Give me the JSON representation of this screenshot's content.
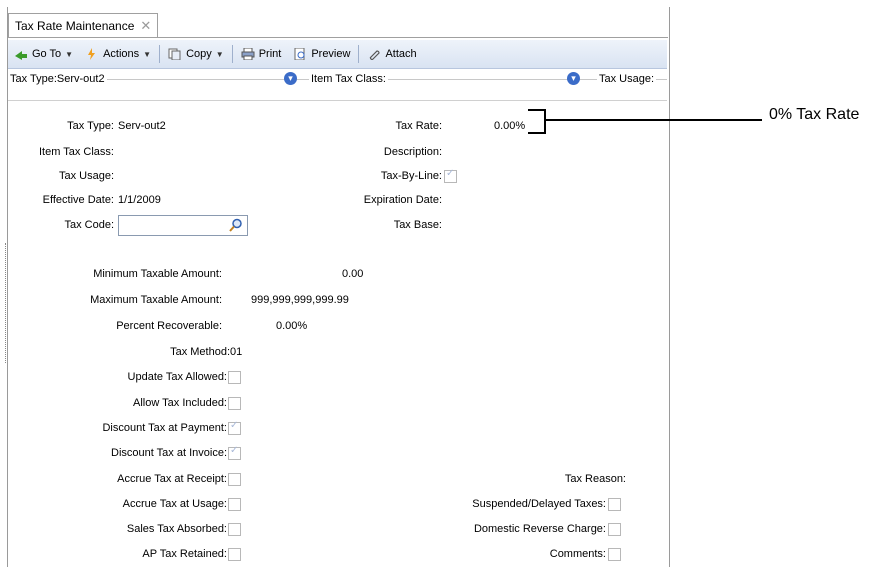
{
  "tab": {
    "title": "Tax Rate Maintenance",
    "close": "✕"
  },
  "toolbar": {
    "goto": "Go To",
    "actions": "Actions",
    "copy": "Copy",
    "print": "Print",
    "preview": "Preview",
    "attach": "Attach"
  },
  "filter": {
    "tax_type": "Tax Type:Serv-out2",
    "item_tax_class": "Item Tax Class:",
    "tax_usage": "Tax Usage:"
  },
  "form": {
    "tax_type_label": "Tax Type:",
    "tax_type_value": "Serv-out2",
    "item_tax_class_label": "Item Tax Class:",
    "tax_usage_label": "Tax Usage:",
    "effective_date_label": "Effective Date:",
    "effective_date_value": "1/1/2009",
    "tax_code_label": "Tax Code:",
    "tax_rate_label": "Tax Rate:",
    "tax_rate_value": "0.00%",
    "description_label": "Description:",
    "tax_by_line_label": "Tax-By-Line:",
    "expiration_date_label": "Expiration Date:",
    "tax_base_label": "Tax Base:",
    "min_taxable_label": "Minimum Taxable Amount:",
    "min_taxable_value": "0.00",
    "max_taxable_label": "Maximum Taxable Amount:",
    "max_taxable_value": "999,999,999,999.99",
    "percent_recoverable_label": "Percent Recoverable:",
    "percent_recoverable_value": "0.00%",
    "tax_method_label": "Tax Method:",
    "tax_method_value": "01",
    "update_tax_allowed_label": "Update Tax Allowed:",
    "allow_tax_included_label": "Allow Tax Included:",
    "discount_payment_label": "Discount Tax at Payment:",
    "discount_invoice_label": "Discount Tax at Invoice:",
    "accrue_receipt_label": "Accrue Tax at Receipt:",
    "accrue_usage_label": "Accrue Tax at Usage:",
    "sales_tax_absorbed_label": "Sales Tax Absorbed:",
    "ap_tax_retained_label": "AP Tax Retained:",
    "tax_reason_label": "Tax Reason:",
    "suspended_label": "Suspended/Delayed Taxes:",
    "domestic_reverse_label": "Domestic Reverse Charge:",
    "comments_label": "Comments:"
  },
  "callout": {
    "text": "0% Tax Rate"
  }
}
